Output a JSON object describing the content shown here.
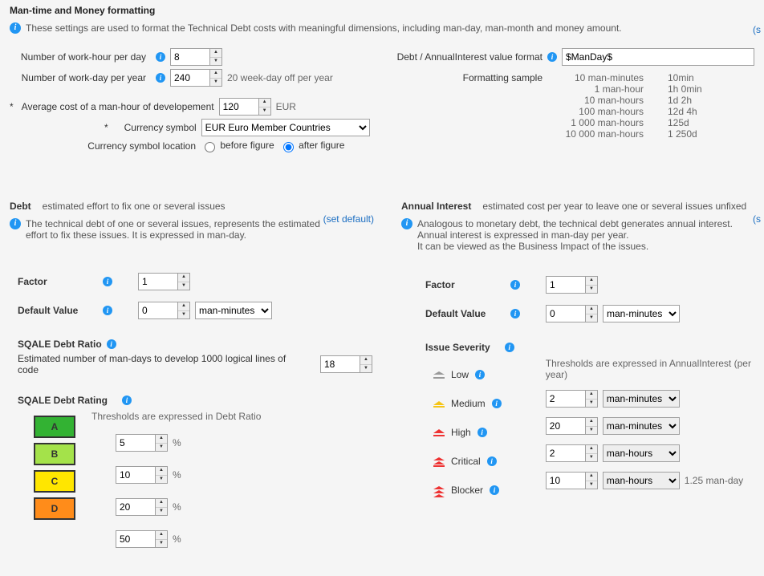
{
  "top": {
    "title": "Man-time and Money formatting",
    "desc": "These settings are used to format the Technical Debt costs with meaningful dimensions, including man-day, man-month and money amount.",
    "workHoursLabel": "Number of work-hour per day",
    "workHoursValue": "8",
    "workDaysLabel": "Number of work-day per year",
    "workDaysValue": "240",
    "workDaysHint": "20 week-day off per year",
    "avgCostLabel": "Average cost of a man-hour of developement",
    "avgCostValue": "120",
    "avgCostCurrency": "EUR",
    "currencySymbolLabel": "Currency symbol",
    "currencySymbolValue": "EUR Euro Member Countries",
    "currencyLocLabel": "Currency symbol location",
    "radioBefore": "before figure",
    "radioAfter": "after figure",
    "formatLabel": "Debt / AnnualInterest value format",
    "formatValue": "$ManDay$",
    "sampleLabel": "Formatting sample",
    "samples": [
      {
        "a": "10 man-minutes",
        "b": "10min"
      },
      {
        "a": "1 man-hour",
        "b": "1h  0min"
      },
      {
        "a": "10 man-hours",
        "b": "1d  2h"
      },
      {
        "a": "100 man-hours",
        "b": "12d  4h"
      },
      {
        "a": "1 000 man-hours",
        "b": "125d"
      },
      {
        "a": "10 000 man-hours",
        "b": "1 250d"
      }
    ],
    "rightLinkChar": "(s"
  },
  "debt": {
    "title": "Debt",
    "subtitle": "estimated effort to fix one or several issues",
    "setDefault": "(set default)",
    "desc": "The technical debt of one or several issues, represents the estimated effort to fix these issues. It is expressed in man-day.",
    "factorLabel": "Factor",
    "factorValue": "1",
    "defaultValueLabel": "Default Value",
    "defaultValueValue": "0",
    "defaultValueUnit": "man-minutes",
    "sqaleRatioTitle": "SQALE Debt Ratio",
    "sqaleRatioDesc": "Estimated number of man-days to develop 1000 logical lines of code",
    "sqaleRatioValue": "18",
    "sqaleRatingTitle": "SQALE Debt Rating",
    "thresholdsLabel": "Thresholds are expressed in Debt Ratio",
    "ratings": [
      {
        "letter": "A",
        "bg": "#33b233",
        "val": "5"
      },
      {
        "letter": "B",
        "bg": "#a4e24a",
        "val": "10"
      },
      {
        "letter": "C",
        "bg": "#ffe600",
        "val": "20"
      },
      {
        "letter": "D",
        "bg": "#ff8c1a",
        "val": "50"
      }
    ],
    "pct": "%"
  },
  "ai": {
    "title": "Annual Interest",
    "subtitle": "estimated cost per year to leave one or several issues unfixed",
    "desc1": "Analogous to monetary debt, the technical debt generates annual interest.",
    "desc2": "Annual interest is expressed in man-day per year.",
    "desc3": "It can be viewed as the Business Impact of the issues.",
    "factorLabel": "Factor",
    "factorValue": "1",
    "defaultValueLabel": "Default Value",
    "defaultValueValue": "0",
    "defaultValueUnit": "man-minutes",
    "issueSeverityTitle": "Issue Severity",
    "thresholdsLabel": "Thresholds are expressed in AnnualInterest (per year)",
    "sev": [
      {
        "name": "Low",
        "cls": "low",
        "val": "2",
        "unit": "man-minutes"
      },
      {
        "name": "Medium",
        "cls": "med",
        "val": "20",
        "unit": "man-minutes"
      },
      {
        "name": "High",
        "cls": "hi",
        "val": "2",
        "unit": "man-hours"
      },
      {
        "name": "Critical",
        "cls": "crit",
        "val": "10",
        "unit": "man-hours"
      },
      {
        "name": "Blocker",
        "cls": "blk",
        "val": "",
        "unit": ""
      }
    ],
    "critHint": "1.25 man-day",
    "rightLinkChar": "(s"
  }
}
